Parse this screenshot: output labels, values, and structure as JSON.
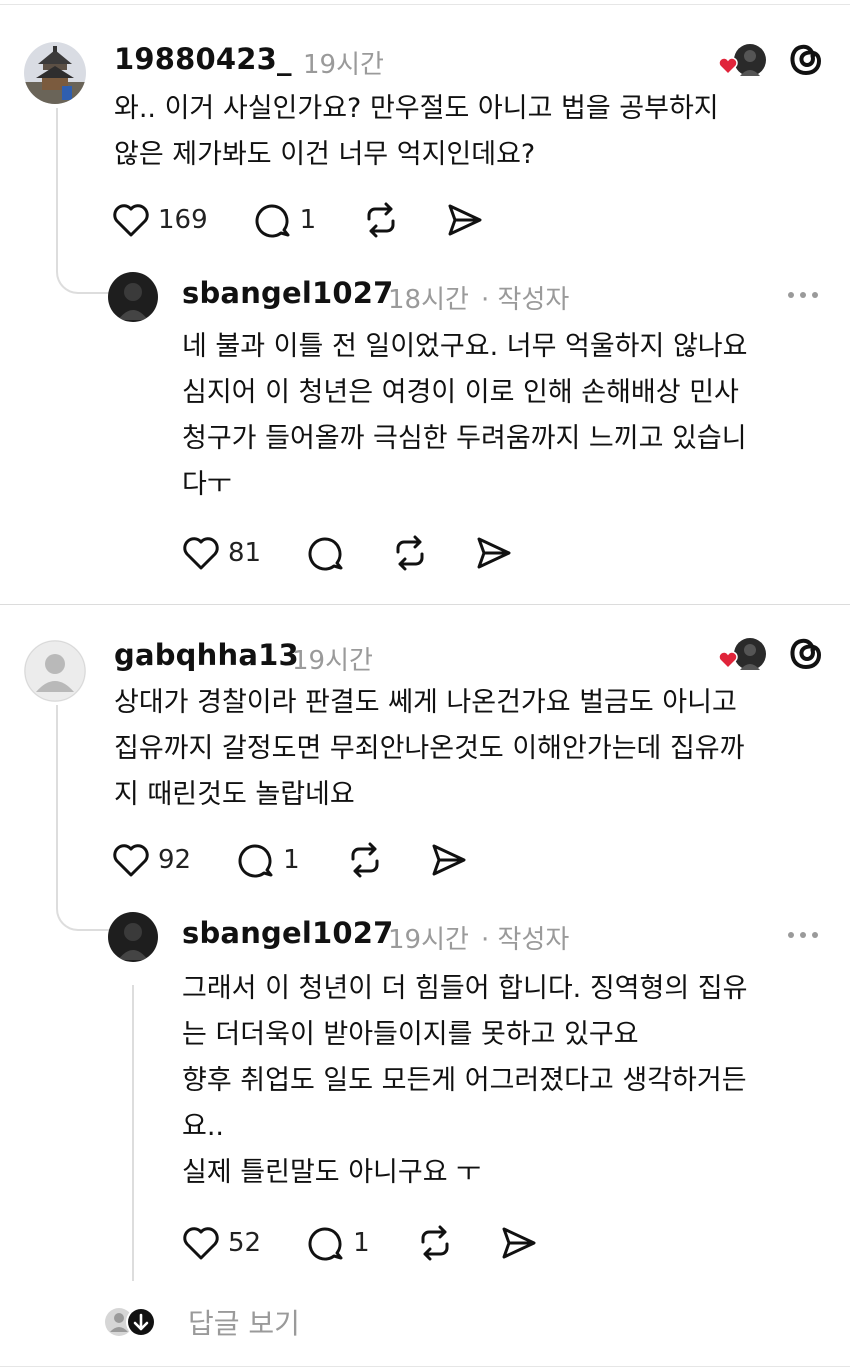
{
  "comments": [
    {
      "username": "19880423_",
      "time": "19시간",
      "lines": [
        "와.. 이거 사실인가요? 만우절도 아니고 법을 공부하지",
        "않은 제가봐도 이건 너무 억지인데요?"
      ],
      "likes": "169",
      "replies": "1",
      "reply": {
        "username": "sbangel1027",
        "time": "18시간",
        "author_tag": "· 작성자",
        "lines": [
          "네 불과 이틀 전 일이었구요. 너무 억울하지 않나요",
          "심지어 이 청년은 여경이 이로 인해 손해배상 민사",
          "청구가 들어올까 극심한 두려움까지 느끼고 있습니",
          "다ㅜ"
        ],
        "likes": "81",
        "replies": ""
      }
    },
    {
      "username": "gabqhha13",
      "time": "19시간",
      "lines": [
        "상대가 경찰이라 판결도 쎄게 나온건가요 벌금도 아니고",
        "집유까지 갈정도면 무죄안나온것도 이해안가는데 집유까",
        "지 때린것도 놀랍네요"
      ],
      "likes": "92",
      "replies": "1",
      "reply": {
        "username": "sbangel1027",
        "time": "19시간",
        "author_tag": "· 작성자",
        "lines": [
          "그래서 이 청년이 더 힘들어 합니다.  징역형의 집유",
          "는 더더욱이 받아들이지를 못하고 있구요",
          "향후 취업도 일도 모든게 어그러졌다고 생각하거든",
          "요..",
          "실제 틀린말도 아니구요 ㅜ"
        ],
        "likes": "52",
        "replies": "1"
      }
    }
  ],
  "view_replies_label": "답글 보기",
  "colors": {
    "heart_red": "#e0243a",
    "muted": "#9a9a9a",
    "text": "#111111"
  },
  "icons": [
    "heart-icon",
    "comment-icon",
    "repost-icon",
    "share-icon",
    "threads-logo-icon",
    "more-icon",
    "arrow-down-icon"
  ]
}
